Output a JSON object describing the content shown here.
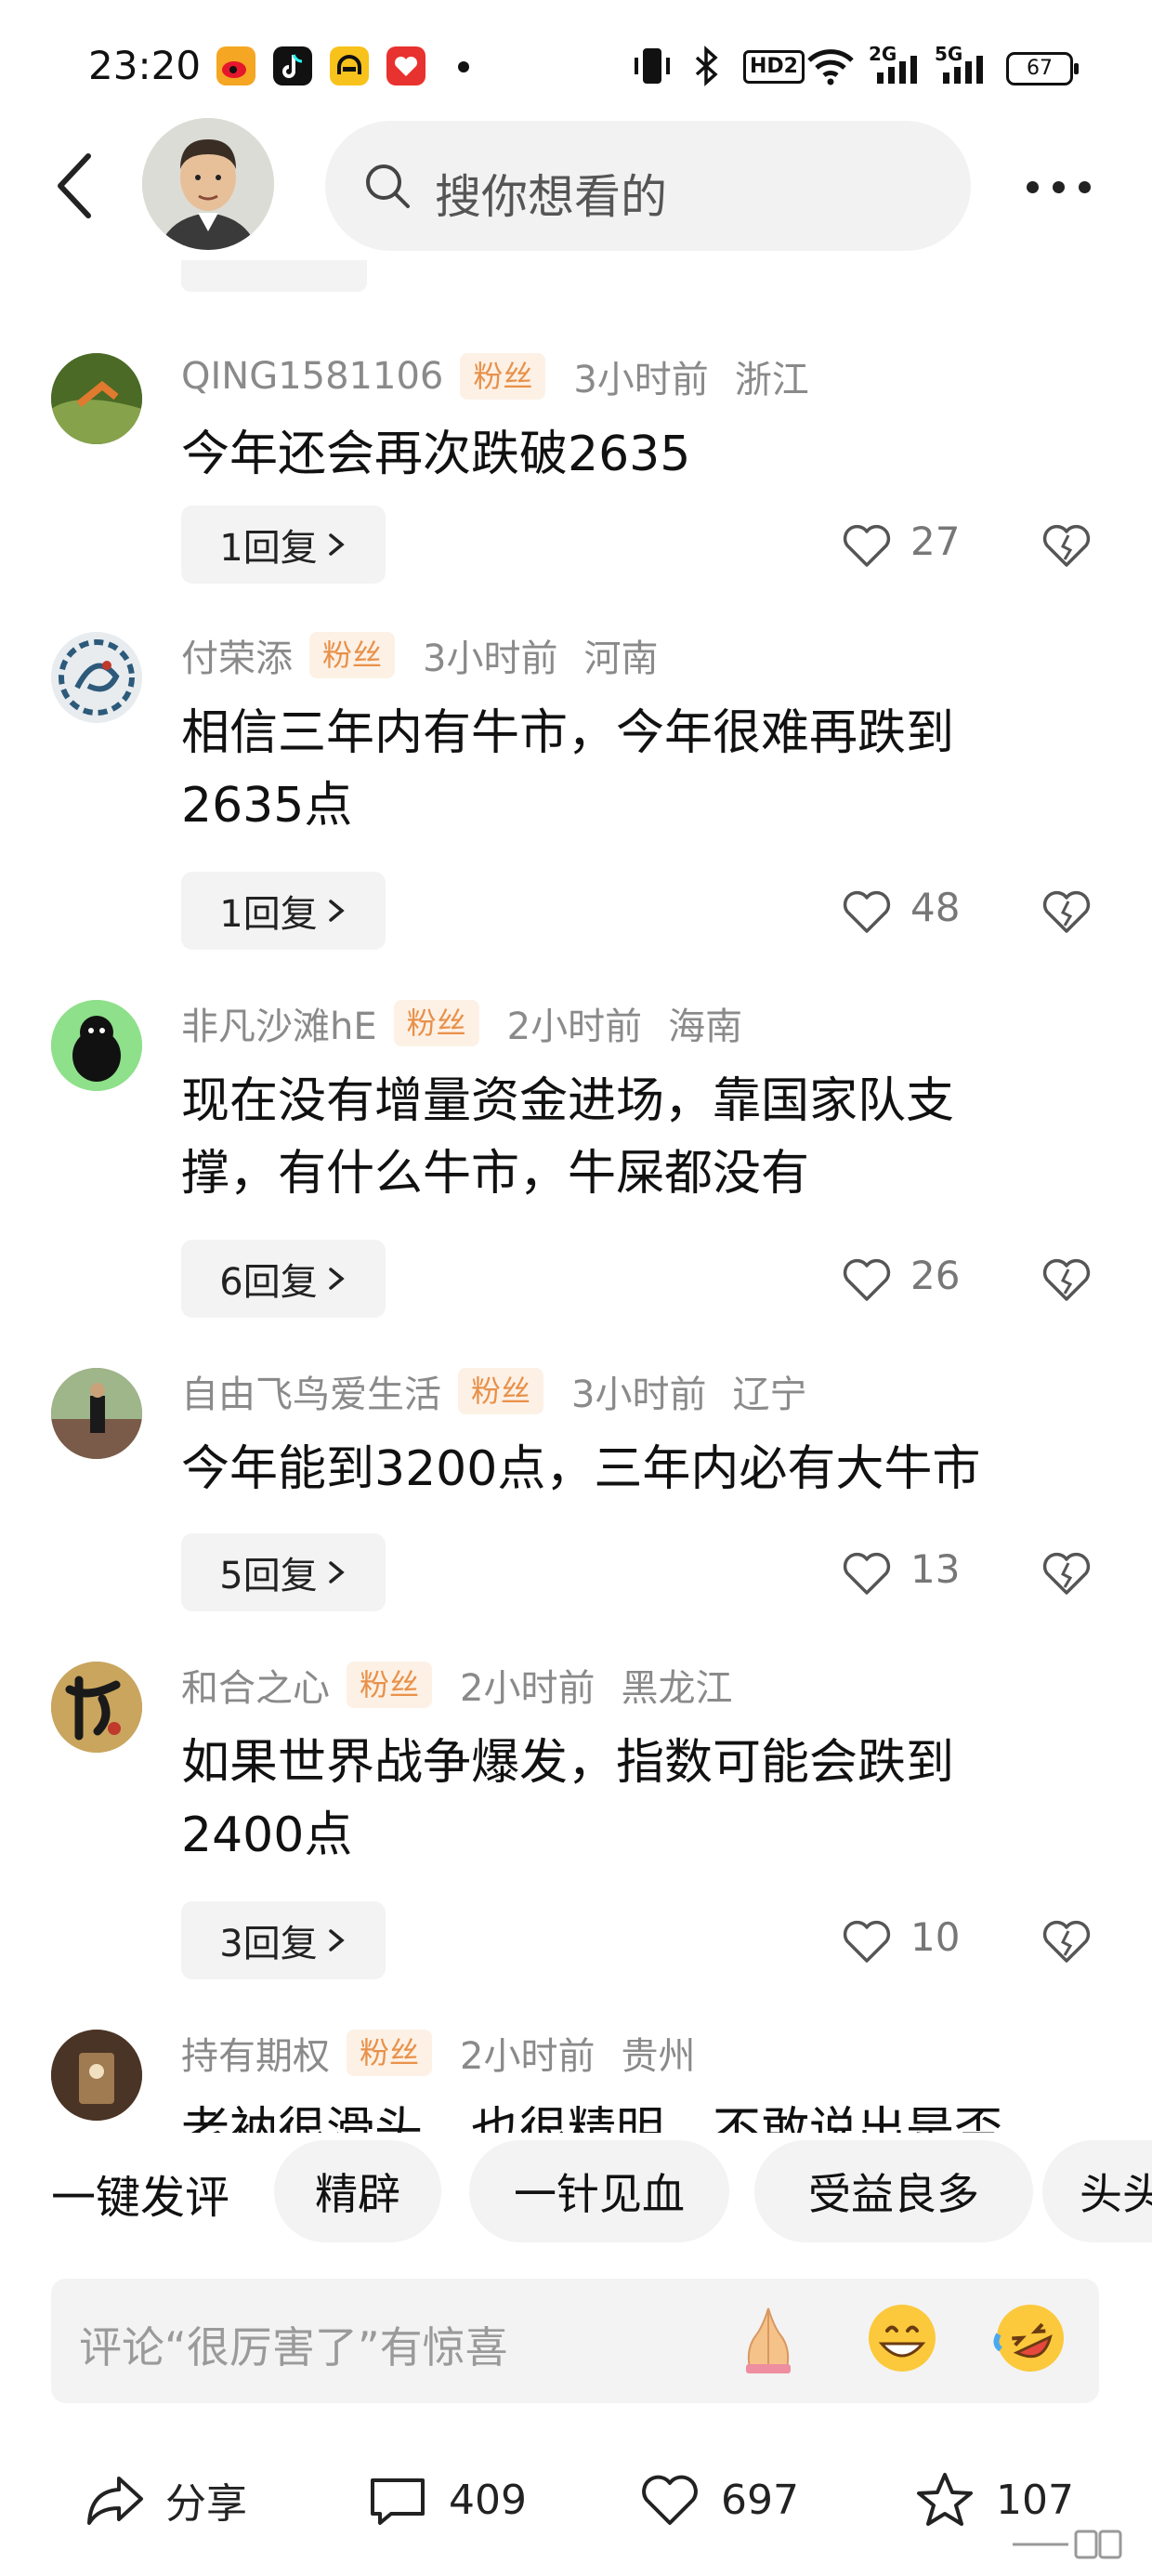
{
  "status_bar": {
    "time": "23:20",
    "apps": [
      {
        "icon": "weibo-app-icon",
        "color": "#f5a623"
      },
      {
        "icon": "douyin-app-icon",
        "color": "#111111"
      },
      {
        "icon": "app-icon-yellow",
        "color": "#f7c21b"
      },
      {
        "icon": "app-icon-red",
        "color": "#e8322f"
      }
    ],
    "hd_label": "HD2",
    "net1": "2G",
    "net2": "5G",
    "battery": "67"
  },
  "header": {
    "search_placeholder": "搜你想看的"
  },
  "comments": [
    {
      "name": "QING1581106",
      "badge": "粉丝",
      "time": "3小时前",
      "region": "浙江",
      "text": "今年还会再次跌破2635",
      "replies": "1回复",
      "likes": "27",
      "avatar_color": "#5b7a2e"
    },
    {
      "name": "付荣添",
      "badge": "粉丝",
      "time": "3小时前",
      "region": "河南",
      "text": "相信三年内有牛市，今年很难再跌到2635点",
      "replies": "1回复",
      "likes": "48",
      "avatar_color": "#2d5a7a"
    },
    {
      "name": "非凡沙滩hE",
      "badge": "粉丝",
      "time": "2小时前",
      "region": "海南",
      "text": "现在没有增量资金进场，靠国家队支撑，有什么牛市，牛屎都没有",
      "replies": "6回复",
      "likes": "26",
      "avatar_color": "#8ee08a"
    },
    {
      "name": "自由飞鸟爱生活",
      "badge": "粉丝",
      "time": "3小时前",
      "region": "辽宁",
      "text": "今年能到3200点，三年内必有大牛市",
      "replies": "5回复",
      "likes": "13",
      "avatar_color": "#6c7a5a"
    },
    {
      "name": "和合之心",
      "badge": "粉丝",
      "time": "2小时前",
      "region": "黑龙江",
      "text": "如果世界战争爆发，指数可能会跌到2400点",
      "replies": "3回复",
      "likes": "10",
      "avatar_color": "#b08a4a"
    },
    {
      "name": "持有期权",
      "badge": "粉丝",
      "time": "2小时前",
      "region": "贵州",
      "text": "老衲很滑头，也很精明，不敢说出是否",
      "replies": "",
      "likes": "",
      "avatar_color": "#5a4030"
    }
  ],
  "quick_comments": {
    "lead": "一键发评",
    "chips": [
      "精辟",
      "一针见血",
      "受益良多",
      "头头"
    ]
  },
  "input": {
    "placeholder": "评论“很厉害了”有惊喜",
    "emojis": [
      "folded-hands-emoji",
      "grinning-emoji",
      "rolling-laughing-emoji"
    ]
  },
  "bottom_bar": {
    "share": "分享",
    "comments": "409",
    "likes": "697",
    "favorites": "107"
  }
}
